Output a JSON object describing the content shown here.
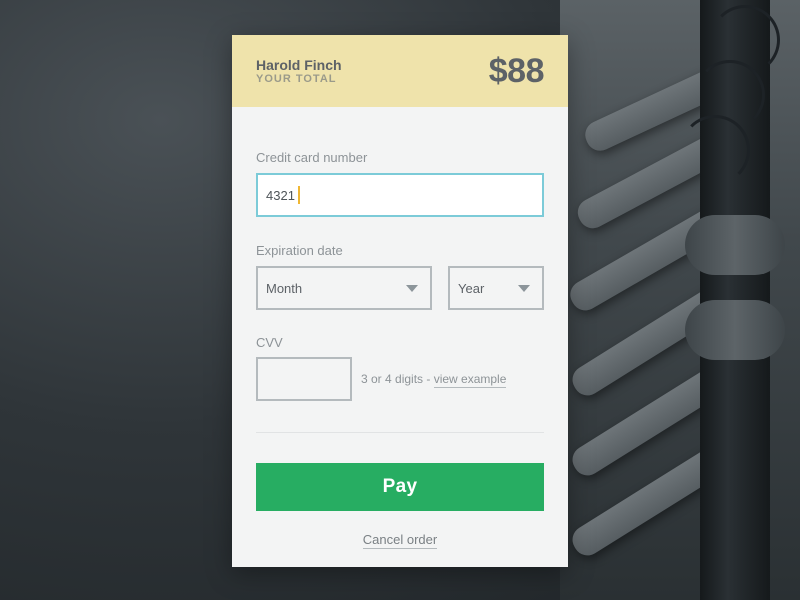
{
  "header": {
    "customer_name": "Harold Finch",
    "total_label": "YOUR TOTAL",
    "total_amount": "$88"
  },
  "form": {
    "card_number_label": "Credit card number",
    "card_number_value": "4321",
    "expiration_label": "Expiration date",
    "month_value": "Month",
    "year_value": "Year",
    "cvv_label": "CVV",
    "cvv_hint_text": "3 or 4 digits - ",
    "cvv_hint_link": "view example"
  },
  "actions": {
    "pay_label": "Pay",
    "cancel_label": "Cancel order"
  },
  "colors": {
    "header_bg": "#efe3ab",
    "pay_button": "#27ad62",
    "input_focus_border": "#7ccbd8",
    "caret": "#f0b733"
  },
  "icons": {
    "select_arrow": "chevron-down-icon"
  }
}
